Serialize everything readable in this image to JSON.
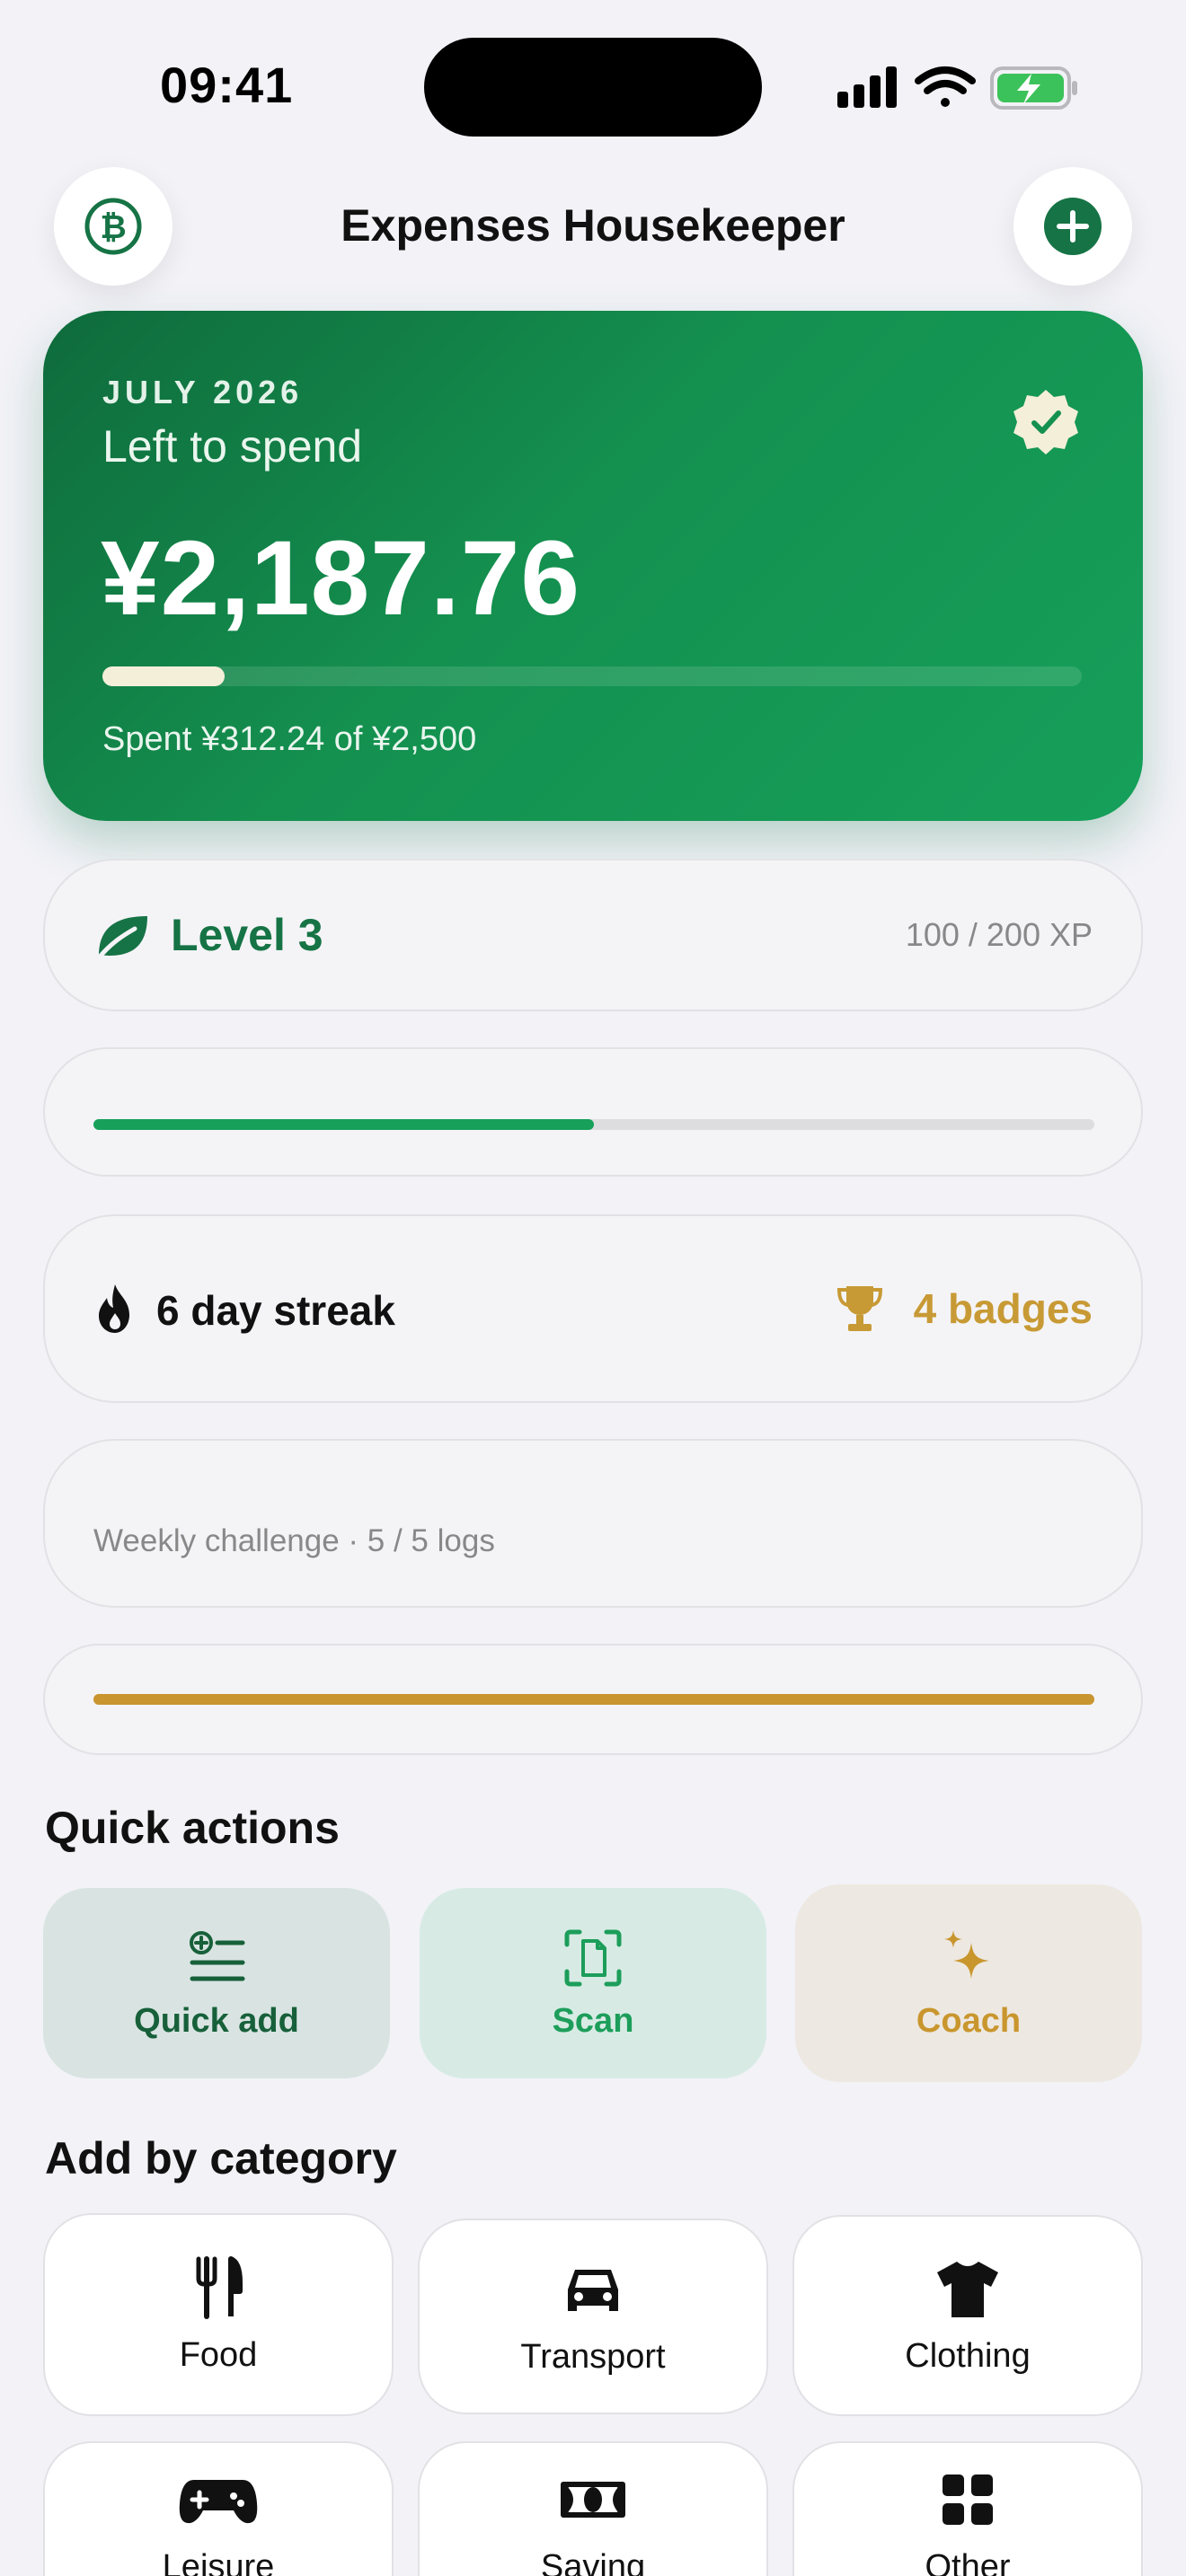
{
  "status_bar": {
    "time": "09:41"
  },
  "header": {
    "title": "Expenses Housekeeper",
    "left_icon": "bitcoin-icon",
    "right_icon": "plus-circle-icon"
  },
  "summary": {
    "month": "JULY 2026",
    "subtitle": "Left to spend",
    "amount": "¥2,187.76",
    "spent_text": "Spent ¥312.24 of ¥2,500",
    "spent_fraction": 0.125,
    "badge_icon": "verified-badge-icon"
  },
  "level": {
    "label": "Level 3",
    "xp_text": "100 / 200 XP",
    "xp_fraction": 0.5,
    "icon": "leaf-icon"
  },
  "streak": {
    "label": "6 day streak",
    "badges_label": "4 badges"
  },
  "weekly": {
    "label": "Weekly challenge · 5 / 5 logs",
    "fraction": 1.0
  },
  "quick_actions": {
    "title": "Quick actions",
    "items": [
      {
        "label": "Quick add",
        "icon": "list-add-icon"
      },
      {
        "label": "Scan",
        "icon": "scan-document-icon"
      },
      {
        "label": "Coach",
        "icon": "sparkles-icon"
      }
    ]
  },
  "categories": {
    "title": "Add by category",
    "items": [
      {
        "label": "Food",
        "icon": "fork-knife-icon"
      },
      {
        "label": "Transport",
        "icon": "car-icon"
      },
      {
        "label": "Clothing",
        "icon": "tshirt-icon"
      },
      {
        "label": "Leisure",
        "icon": "gamepad-icon"
      },
      {
        "label": "Saving",
        "icon": "banknote-icon"
      },
      {
        "label": "Other",
        "icon": "grid-icon"
      }
    ]
  },
  "colors": {
    "brand_green": "#16a05a",
    "dark_green": "#167345",
    "gold": "#c9952f"
  }
}
